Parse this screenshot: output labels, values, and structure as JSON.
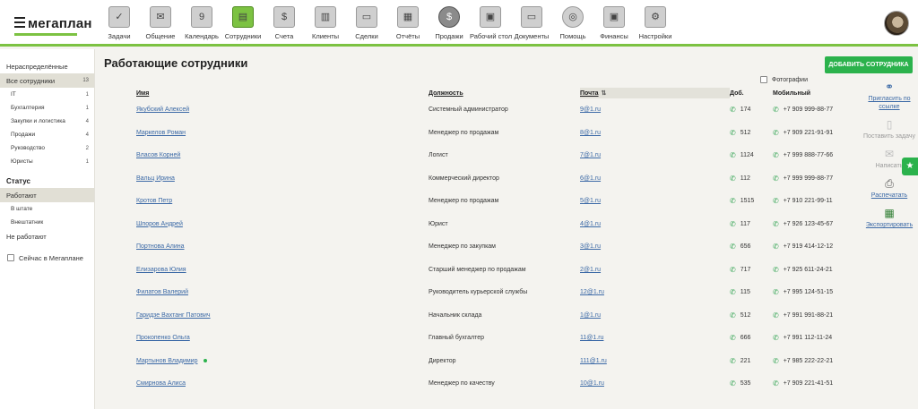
{
  "app": {
    "logo_text": "мегаплан"
  },
  "nav": [
    {
      "label": "Задачи",
      "icon": "tasks-icon",
      "glyph": "✓"
    },
    {
      "label": "Общение",
      "icon": "chat-icon",
      "glyph": "✉"
    },
    {
      "label": "Календарь",
      "icon": "calendar-icon",
      "glyph": "9"
    },
    {
      "label": "Сотрудники",
      "icon": "employees-icon",
      "glyph": "▤",
      "active": true
    },
    {
      "label": "Счета",
      "icon": "invoices-icon",
      "glyph": "$"
    },
    {
      "label": "Клиенты",
      "icon": "clients-icon",
      "glyph": "▥"
    },
    {
      "label": "Сделки",
      "icon": "deals-icon",
      "glyph": "▭"
    },
    {
      "label": "Отчёты",
      "icon": "reports-icon",
      "glyph": "▦"
    },
    {
      "label": "Продажи",
      "icon": "sales-icon",
      "glyph": "$"
    },
    {
      "label": "Рабочий стол",
      "icon": "desktop-icon",
      "glyph": "▣"
    },
    {
      "label": "Документы",
      "icon": "documents-icon",
      "glyph": "▭"
    },
    {
      "label": "Помощь",
      "icon": "help-icon",
      "glyph": "◎"
    },
    {
      "label": "Финансы",
      "icon": "finance-icon",
      "glyph": "▣"
    },
    {
      "label": "Настройки",
      "icon": "settings-icon",
      "glyph": "⚙"
    }
  ],
  "sidebar": {
    "unassigned": "Нераспределённые",
    "all_staff": {
      "label": "Все сотрудники",
      "count": "13"
    },
    "departments": [
      {
        "label": "IT",
        "count": "1"
      },
      {
        "label": "Бухгалтерия",
        "count": "1"
      },
      {
        "label": "Закупки и логистика",
        "count": "4"
      },
      {
        "label": "Продажи",
        "count": "4"
      },
      {
        "label": "Руководство",
        "count": "2"
      },
      {
        "label": "Юристы",
        "count": "1"
      }
    ],
    "status_heading": "Статус",
    "working": "Работают",
    "in_staff": "В штате",
    "freelance": "Внештатник",
    "not_working": "Не работают",
    "now_online": "Сейчас в Мегаплане"
  },
  "main": {
    "title": "Работающие сотрудники",
    "add_button": "ДОБАВИТЬ СОТРУДНИКА",
    "photos_label": "Фотографии",
    "columns": {
      "name": "Имя",
      "position": "Должность",
      "email": "Почта",
      "ext": "Доб.",
      "mobile": "Мобильный"
    },
    "rows": [
      {
        "name": "Якубский Алексей",
        "position": "Системный администратор",
        "email": "9@1.ru",
        "ext": "174",
        "mobile": "+7 909 999-88-77"
      },
      {
        "name": "Маркелов Роман",
        "position": "Менеджер по продажам",
        "email": "8@1.ru",
        "ext": "512",
        "mobile": "+7 909 221-91-91"
      },
      {
        "name": "Власов Корней",
        "position": "Логист",
        "email": "7@1.ru",
        "ext": "1124",
        "mobile": "+7 999 888-77-66"
      },
      {
        "name": "Вальц Ирина",
        "position": "Коммерческий директор",
        "email": "6@1.ru",
        "ext": "112",
        "mobile": "+7 999 999-88-77"
      },
      {
        "name": "Кротов Петр",
        "position": "Менеджер по продажам",
        "email": "5@1.ru",
        "ext": "1515",
        "mobile": "+7 910 221-99-11"
      },
      {
        "name": "Шпоров Андрей",
        "position": "Юрист",
        "email": "4@1.ru",
        "ext": "117",
        "mobile": "+7 926 123-45-67"
      },
      {
        "name": "Портнова Алина",
        "position": "Менеджер по закупкам",
        "email": "3@1.ru",
        "ext": "656",
        "mobile": "+7 919 414-12-12"
      },
      {
        "name": "Елизарова Юлия",
        "position": "Старший менеджер по продажам",
        "email": "2@1.ru",
        "ext": "717",
        "mobile": "+7 925 611-24-21"
      },
      {
        "name": "Филатов Валерий",
        "position": "Руководитель курьерской службы",
        "email": "12@1.ru",
        "ext": "115",
        "mobile": "+7 995 124-51-15"
      },
      {
        "name": "Гаридзе Вахтанг Патович",
        "position": "Начальник склада",
        "email": "1@1.ru",
        "ext": "512",
        "mobile": "+7 991 991-88-21"
      },
      {
        "name": "Прокопенко Ольга",
        "position": "Главный бухгалтер",
        "email": "11@1.ru",
        "ext": "666",
        "mobile": "+7 991 112-11-24"
      },
      {
        "name": "Мартынов Владимир",
        "position": "Директор",
        "email": "111@1.ru",
        "ext": "221",
        "mobile": "+7 985 222-22-21",
        "online": true
      },
      {
        "name": "Смирнова Алиса",
        "position": "Менеджер по качеству",
        "email": "10@1.ru",
        "ext": "535",
        "mobile": "+7 909 221-41-51"
      }
    ]
  },
  "actions": {
    "invite": "Пригласить по ссылке",
    "create_task": "Поставить задачу",
    "write": "Написать",
    "print": "Распечатать",
    "export": "Экспортировать"
  },
  "colors": {
    "accent": "#7cc242",
    "primary_button": "#2bb24c",
    "link": "#3b69a6"
  }
}
